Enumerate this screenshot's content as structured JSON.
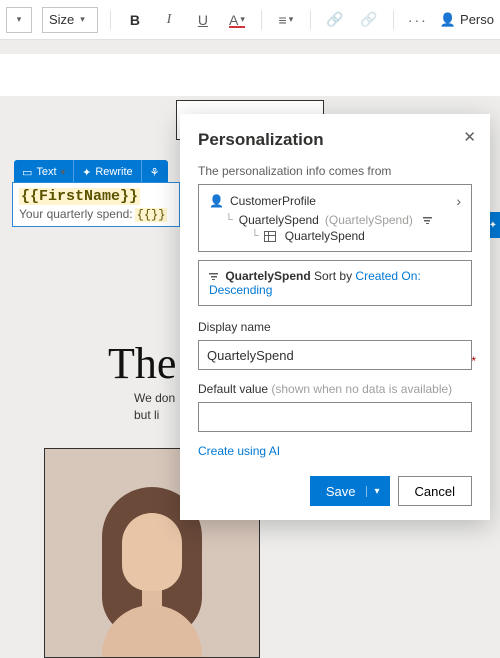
{
  "toolbar": {
    "size_label": "Size",
    "bold": "B",
    "italic": "I",
    "under": "U",
    "fontcolor": "A",
    "perso_label": "Perso"
  },
  "context_bar": {
    "text": "Text",
    "rewrite": "Rewrite"
  },
  "canvas": {
    "token": "{{FirstName}}",
    "spend_line": "Your quarterly spend:",
    "spend_slot": "{{}}",
    "hero": "The",
    "sub_l1": "We don",
    "sub_l2": "but li"
  },
  "panel": {
    "title": "Personalization",
    "src_label": "The personalization info comes from",
    "src_root": "CustomerProfile",
    "src_mid": "QuartelySpend",
    "src_mid_paren": "(QuartelySpend)",
    "src_leaf": "QuartelySpend",
    "sort_prefix": "QuartelySpend",
    "sort_text": "Sort by",
    "sort_link": "Created On: Descending",
    "display_label": "Display name",
    "display_value": "QuartelySpend",
    "default_label": "Default value",
    "default_hint": "(shown when no data is available)",
    "default_value": "",
    "ai_link": "Create using AI",
    "save": "Save",
    "cancel": "Cancel"
  }
}
